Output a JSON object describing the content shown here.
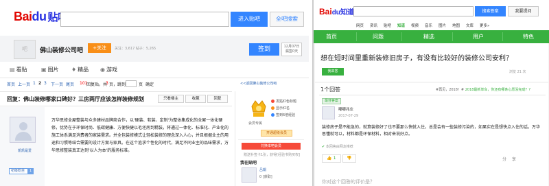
{
  "tieba": {
    "logo": {
      "bai": "Bai",
      "paw": "du",
      "name": "贴吧"
    },
    "search": {
      "placeholder": "",
      "enter_label": "进入贴吧",
      "all_label": "全吧搜索"
    },
    "forum": {
      "avatar_text": "吧",
      "name": "佛山装修公司吧",
      "follow_label": "+关注",
      "stats": "关注：3,617  帖子：5,265",
      "sign_label": "签到",
      "date_label": "12月07日",
      "date_sub": "漏签0天"
    },
    "tabs": [
      {
        "icon": "▤",
        "label": "看贴"
      },
      {
        "icon": "▣",
        "label": "图片"
      },
      {
        "icon": "♦",
        "label": "精品"
      },
      {
        "icon": "◉",
        "label": "游戏"
      }
    ],
    "pager": {
      "first": "首页",
      "prev": "上一页",
      "p1": "1",
      "p2": "2",
      "p3": "3",
      "next": "下一页",
      "last": "尾页",
      "replies_count": "101",
      "replies_text": "回复贴，共",
      "pages_count": "3",
      "pages_text": "页，跳到",
      "page_unit": "页",
      "jump": "确定",
      "return_link": "<<返回佛山装修公司吧"
    },
    "post": {
      "title": "回复：佛山装修哪家口碑好？三房两厅应该怎样装修规划",
      "only_host": "只看楼主",
      "favorite": "收藏",
      "reply": "回复",
      "user_name": "凯凯是爱",
      "level_name": "初级粉丝",
      "level_num": "1",
      "content": "万华思修全屋整装与众多建材品牌商合作，以'硬装、软装、定制'为整体集成化的全屋一体化硬修，优势在于环保时尚、低碳健康、方便快捷以毛坯房到精装，将通过一体化、标准化、产业化的施工体系满足消费者的家装需求。并全包装修模式让轻松装修的理念深入人心，并且根据业主的用途和习惯等结合需要的设计方案与家具。在这个追求个性化的时代，满足不同业主的品味需求，万华思修整装真正达到'以人为本'的服务标准。"
    },
    "sidebar": {
      "medal_label": "会员专属",
      "items": [
        {
          "label": "发贴红色标题"
        },
        {
          "label": "显示红名"
        },
        {
          "label": "签到6倍经验"
        }
      ],
      "member_button": "开通超级会员",
      "ad_button": "兑换本吧会员",
      "ad_note": "赠送补签卡1张，获得[经验书购买权]",
      "in_tieba": "我在贴吧",
      "my_name": "吕娟",
      "my_level": "0 [获取]"
    }
  },
  "zhidao": {
    "logo": {
      "bai": "Bai",
      "du": "du",
      "name": "知道"
    },
    "search": {
      "placeholder": "",
      "search_label": "搜索答案",
      "ask_label": "我要提问"
    },
    "subnav": [
      "网页",
      "资讯",
      "贴吧",
      "知道",
      "视频",
      "音乐",
      "图片",
      "地图",
      "文库",
      "更多»"
    ],
    "active_subnav": "知道",
    "nav": [
      "首页",
      "问题",
      "精选",
      "用户",
      "特色"
    ],
    "question": {
      "title": "想在短时间里重新装修旧房子，有没有比较好的装修公司安利？",
      "i_want": "我来答",
      "views": "浏览 21 次"
    },
    "answers": {
      "count": "1个回答",
      "meta_user": "#再见，2018！#",
      "meta_event": "2018最新单车，你还有哪条心愿没完成？?",
      "best_label": "最佳答案",
      "user_name": "嘟嘟兆业",
      "user_date": "2017-07-29",
      "content": "装修房子是不能急的，就算装修好了也不要那么快就入住，总是会有一些装修污染的，如果实在是想快点入住的话，万华思懂就可以，材料都是环保材料，相对来说好点。",
      "cert": "本回答由网友推荐",
      "likes": "1",
      "dislikes": "",
      "share": "分 享",
      "related": "你对这个回答的评价是？"
    }
  },
  "colors": {
    "tieba_blue": "#3385ff",
    "zhidao_green": "#38b03f",
    "follow_orange": "#f98f18"
  }
}
